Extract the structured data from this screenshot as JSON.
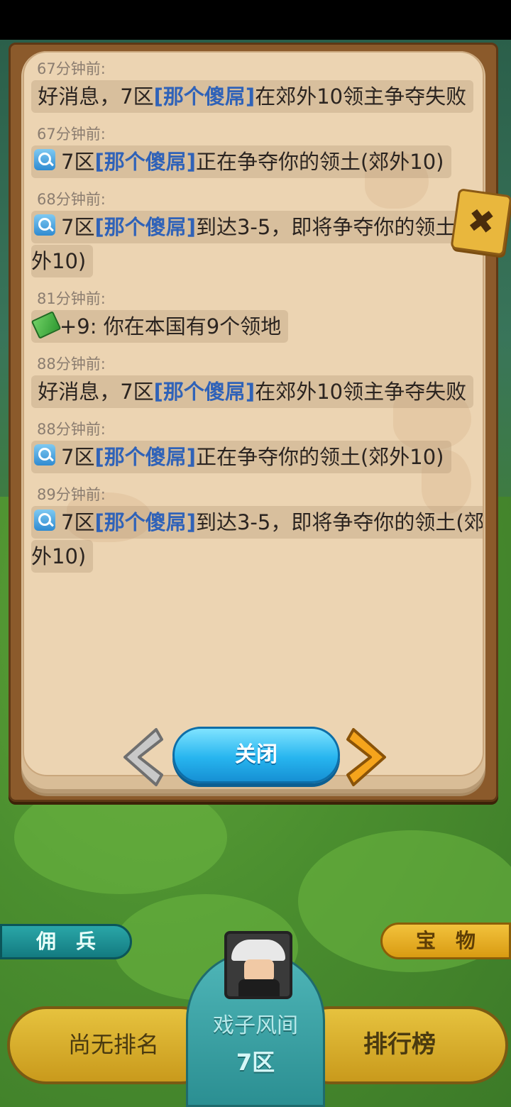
{
  "feed": [
    {
      "time": "67分钟前:",
      "icon": "",
      "prefix": "好消息，7区",
      "name": "[那个傻屌]",
      "suffix": "在郊外10领主争夺失败"
    },
    {
      "time": "67分钟前:",
      "icon": "search-icon",
      "prefix": "7区",
      "name": "[那个傻屌]",
      "suffix": "正在争夺你的领土(郊外10)"
    },
    {
      "time": "68分钟前:",
      "icon": "search-icon",
      "prefix": "7区",
      "name": "[那个傻屌]",
      "suffix": "到达3-5，即将争夺你的领土(郊外10)"
    },
    {
      "time": "81分钟前:",
      "icon": "money-icon",
      "prefix": "+9: 你在本国有9个领地",
      "name": "",
      "suffix": ""
    },
    {
      "time": "88分钟前:",
      "icon": "",
      "prefix": "好消息，7区",
      "name": "[那个傻屌]",
      "suffix": "在郊外10领主争夺失败"
    },
    {
      "time": "88分钟前:",
      "icon": "search-icon",
      "prefix": "7区",
      "name": "[那个傻屌]",
      "suffix": "正在争夺你的领土(郊外10)"
    },
    {
      "time": "89分钟前:",
      "icon": "search-icon",
      "prefix": "7区",
      "name": "[那个傻屌]",
      "suffix": "到达3-5，即将争夺你的领土(郊外10)"
    }
  ],
  "dialog": {
    "close_label": "关闭"
  },
  "hud": {
    "mercenary_label": "佣　兵",
    "treasure_label": "宝　物",
    "rank_status": "尚无排名",
    "player_name": "戏子风间",
    "player_zone": "7区",
    "leaderboard_label": "排行榜"
  }
}
